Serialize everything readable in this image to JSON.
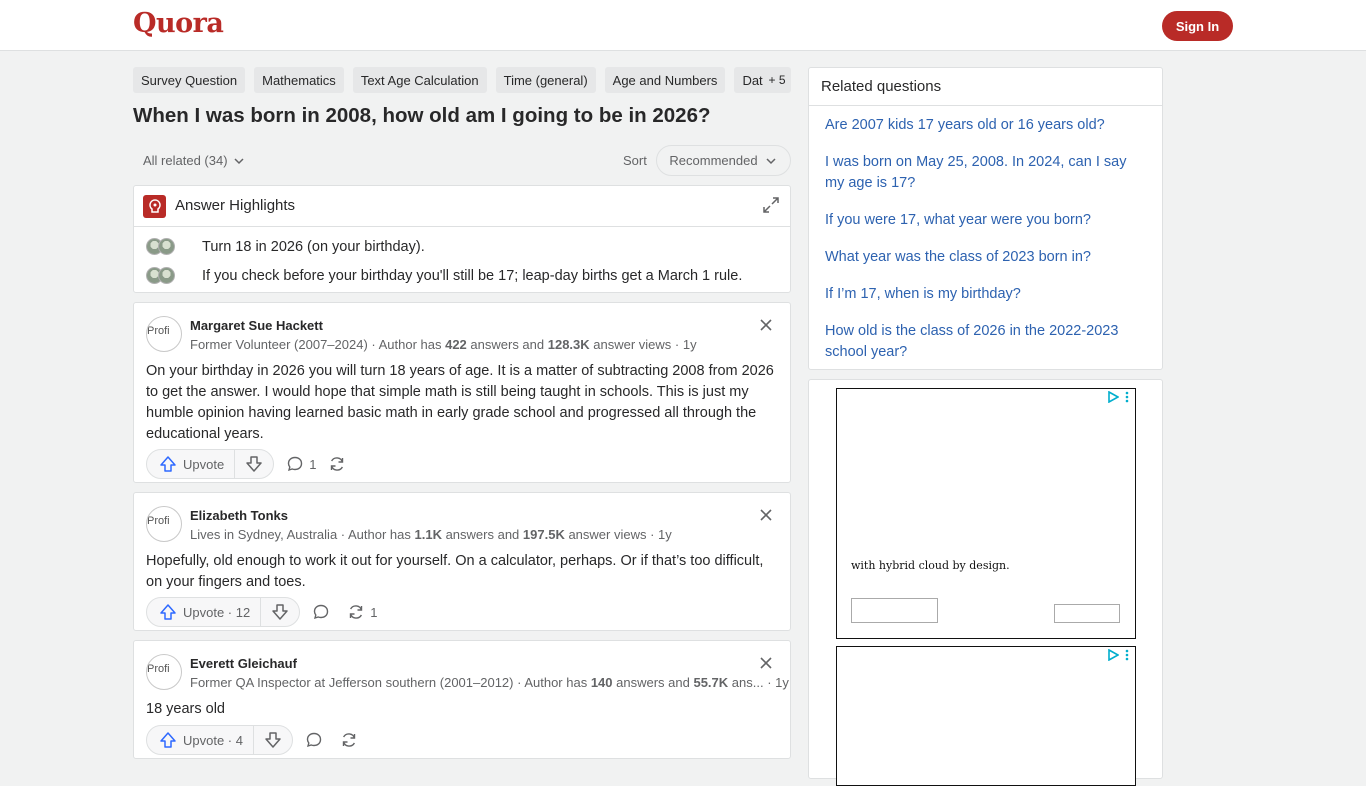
{
  "header": {
    "logo": "Quora",
    "signin_label": "Sign In"
  },
  "topics": [
    "Survey Question",
    "Mathematics",
    "Text Age Calculation",
    "Time (general)",
    "Age and Numbers",
    "Date"
  ],
  "topics_more": "+ 5",
  "question": {
    "title": "When I was born in 2008, how old am I going to be in 2026?"
  },
  "filters": {
    "all_related": "All related (34)",
    "sort_label": "Sort",
    "sort_value": "Recommended"
  },
  "highlights": {
    "title": "Answer Highlights",
    "items": [
      "Turn 18 in 2026 (on your birthday).",
      "If you check before your birthday you'll still be 17; leap-day births get a March 1 rule."
    ]
  },
  "answers": [
    {
      "avatar_alt": "Profi",
      "name": "Margaret Sue Hackett",
      "cred_prefix": "Former Volunteer (2007–2024) · Author has ",
      "answers_count": "422",
      "cred_mid": " answers and ",
      "views": "128.3K",
      "cred_suffix": " answer views · 1y",
      "body": "On your birthday in 2026 you will turn 18 years of age. It is a matter of subtracting 2008 from 2026 to get the answer. I would hope that simple math is still being taught in schools. This is just my humble opinion having learned basic math in early grade school and progressed all through the educational years.",
      "upvote_label": "Upvote",
      "comments": "1",
      "shares": ""
    },
    {
      "avatar_alt": "Profi",
      "name": "Elizabeth Tonks",
      "cred_prefix": "Lives in Sydney, Australia · Author has ",
      "answers_count": "1.1K",
      "cred_mid": " answers and ",
      "views": "197.5K",
      "cred_suffix": " answer views · 1y",
      "body": "Hopefully, old enough to work it out for yourself. On a calculator, perhaps. Or if that’s too difficult, on your fingers and toes.",
      "upvote_label": "Upvote · 12",
      "comments": "",
      "shares": "1"
    },
    {
      "avatar_alt": "Profi",
      "name": "Everett Gleichauf",
      "cred_prefix": "Former QA Inspector at Jefferson southern (2001–2012) · Author has ",
      "answers_count": "140",
      "cred_mid": " answers and ",
      "views": "55.7K",
      "cred_suffix": " ans...",
      "time": " · 1y",
      "body": "18 years old",
      "upvote_label": "Upvote · 4",
      "comments": "",
      "shares": ""
    }
  ],
  "related": {
    "title": "Related questions",
    "links": [
      "Are 2007 kids 17 years old or 16 years old?",
      "I was born on May 25, 2008. In 2024, can I say my age is 17?",
      "If you were 17, what year were you born?",
      "What year was the class of 2023 born in?",
      "If I’m 17, when is my birthday?",
      "How old is the class of 2026 in the 2022-2023 school year?"
    ]
  },
  "ad": {
    "text": "with hybrid cloud by design."
  },
  "colors": {
    "brand": "#b92b27",
    "link": "#2d62b0",
    "upvote": "#2e69ff"
  },
  "icons": [
    "upvote-icon",
    "downvote-icon",
    "comment-icon",
    "share-icon",
    "close-icon",
    "expand-icon",
    "chevron-down-icon",
    "ad-choices-icon"
  ]
}
